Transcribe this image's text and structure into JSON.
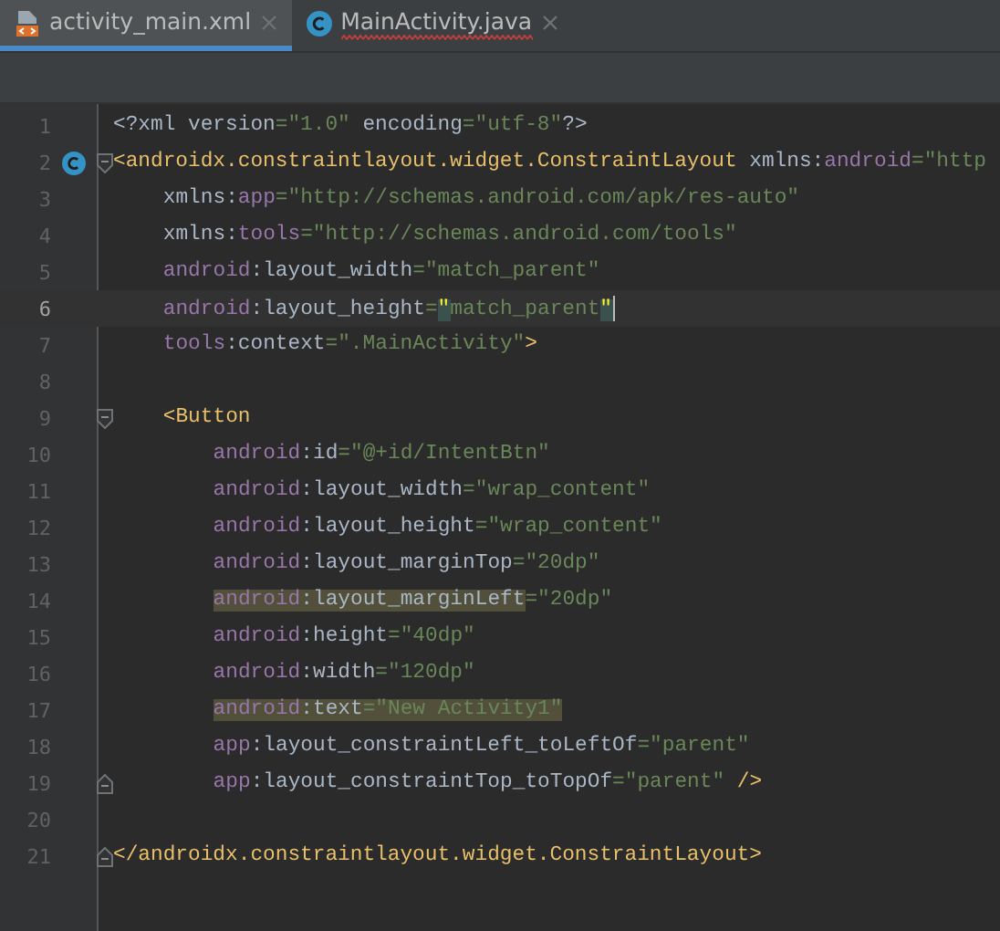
{
  "tabs": [
    {
      "label": "activity_main.xml",
      "kind": "xml",
      "selected": true,
      "misspelled": false
    },
    {
      "label": "MainActivity.java",
      "kind": "java",
      "selected": false,
      "misspelled": true
    }
  ],
  "lines": [
    {
      "number": "1",
      "current": false,
      "class_marker": false,
      "fold_start": false,
      "fold_end": false,
      "tokens": [
        {
          "kind": "plain",
          "text": "<?xml version"
        },
        {
          "kind": "value",
          "text": "=\"1.0\""
        },
        {
          "kind": "plain",
          "text": " encoding"
        },
        {
          "kind": "value",
          "text": "=\"utf-8\""
        },
        {
          "kind": "plain",
          "text": "?>"
        }
      ]
    },
    {
      "number": "2",
      "current": false,
      "class_marker": true,
      "fold_start": true,
      "fold_end": false,
      "tokens": [
        {
          "kind": "tag",
          "text": "<androidx.constraintlayout.widget.ConstraintLayout "
        },
        {
          "kind": "plain",
          "text": "xmlns:"
        },
        {
          "kind": "ns",
          "text": "android"
        },
        {
          "kind": "value",
          "text": "=\"http"
        }
      ],
      "children": [
        {
          "number": "3",
          "current": false,
          "class_marker": false,
          "fold_start": false,
          "fold_end": false,
          "tokens": [
            {
              "kind": "plain",
              "text": "xmlns:"
            },
            {
              "kind": "ns",
              "text": "app"
            },
            {
              "kind": "value",
              "text": "=\"http://schemas.android.com/apk/res-auto\""
            }
          ]
        },
        {
          "number": "4",
          "current": false,
          "class_marker": false,
          "fold_start": false,
          "fold_end": false,
          "tokens": [
            {
              "kind": "plain",
              "text": "xmlns:"
            },
            {
              "kind": "ns",
              "text": "tools"
            },
            {
              "kind": "value",
              "text": "=\"http://schemas.android.com/tools\""
            }
          ]
        },
        {
          "number": "5",
          "current": false,
          "class_marker": false,
          "fold_start": false,
          "fold_end": false,
          "tokens": [
            {
              "kind": "ns",
              "text": "android"
            },
            {
              "kind": "plain",
              "text": ":layout_width"
            },
            {
              "kind": "value",
              "text": "=\"match_parent\""
            }
          ]
        },
        {
          "number": "6",
          "current": true,
          "class_marker": false,
          "fold_start": false,
          "fold_end": false,
          "tokens": [
            {
              "kind": "ns",
              "text": "android"
            },
            {
              "kind": "plain",
              "text": ":layout_height"
            },
            {
              "kind": "value",
              "text": "="
            },
            {
              "kind": "value",
              "text": "\"",
              "matched": true
            },
            {
              "kind": "value",
              "text": "match_parent"
            },
            {
              "kind": "value",
              "text": "\"",
              "matched": true
            }
          ]
        },
        {
          "number": "7",
          "current": false,
          "class_marker": false,
          "fold_start": false,
          "fold_end": false,
          "tokens": [
            {
              "kind": "ns",
              "text": "tools"
            },
            {
              "kind": "plain",
              "text": ":context"
            },
            {
              "kind": "value",
              "text": "=\".MainActivity\""
            },
            {
              "kind": "tag",
              "text": ">"
            }
          ]
        },
        {
          "number": "8",
          "current": false,
          "class_marker": false,
          "fold_start": false,
          "fold_end": false
        },
        {
          "number": "9",
          "current": false,
          "class_marker": false,
          "fold_start": true,
          "fold_end": false,
          "tokens": [
            {
              "kind": "tag",
              "text": "<Button"
            }
          ],
          "children": [
            {
              "number": "10",
              "current": false,
              "class_marker": false,
              "fold_start": false,
              "fold_end": false,
              "tokens": [
                {
                  "kind": "ns",
                  "text": "android"
                },
                {
                  "kind": "plain",
                  "text": ":id"
                },
                {
                  "kind": "value",
                  "text": "=\"@+id/IntentBtn\""
                }
              ]
            },
            {
              "number": "11",
              "current": false,
              "class_marker": false,
              "fold_start": false,
              "fold_end": false,
              "tokens": [
                {
                  "kind": "ns",
                  "text": "android"
                },
                {
                  "kind": "plain",
                  "text": ":layout_width"
                },
                {
                  "kind": "value",
                  "text": "=\"wrap_content\""
                }
              ]
            },
            {
              "number": "12",
              "current": false,
              "class_marker": false,
              "fold_start": false,
              "fold_end": false,
              "tokens": [
                {
                  "kind": "ns",
                  "text": "android"
                },
                {
                  "kind": "plain",
                  "text": ":layout_height"
                },
                {
                  "kind": "value",
                  "text": "=\"wrap_content\""
                }
              ]
            },
            {
              "number": "13",
              "current": false,
              "class_marker": false,
              "fold_start": false,
              "fold_end": false,
              "tokens": [
                {
                  "kind": "ns",
                  "text": "android"
                },
                {
                  "kind": "plain",
                  "text": ":layout_marginTop"
                },
                {
                  "kind": "value",
                  "text": "=\"20dp\""
                }
              ]
            },
            {
              "number": "14",
              "current": false,
              "class_marker": false,
              "fold_start": false,
              "fold_end": false,
              "tokens": [
                {
                  "kind": "ns",
                  "text": "android",
                  "highlight": true
                },
                {
                  "kind": "plain",
                  "text": ":layout_marginLeft",
                  "highlight": true
                },
                {
                  "kind": "value",
                  "text": "=\"20dp\""
                }
              ]
            },
            {
              "number": "15",
              "current": false,
              "class_marker": false,
              "fold_start": false,
              "fold_end": false,
              "tokens": [
                {
                  "kind": "ns",
                  "text": "android"
                },
                {
                  "kind": "plain",
                  "text": ":height"
                },
                {
                  "kind": "value",
                  "text": "=\"40dp\""
                }
              ]
            },
            {
              "number": "16",
              "current": false,
              "class_marker": false,
              "fold_start": false,
              "fold_end": false,
              "tokens": [
                {
                  "kind": "ns",
                  "text": "android"
                },
                {
                  "kind": "plain",
                  "text": ":width"
                },
                {
                  "kind": "value",
                  "text": "=\"120dp\""
                }
              ]
            },
            {
              "number": "17",
              "current": false,
              "class_marker": false,
              "fold_start": false,
              "fold_end": false,
              "tokens": [
                {
                  "kind": "ns",
                  "text": "android",
                  "highlight": true
                },
                {
                  "kind": "plain",
                  "text": ":text",
                  "highlight": true
                },
                {
                  "kind": "value",
                  "text": "=\"New Activity1\"",
                  "highlight": true
                }
              ]
            },
            {
              "number": "18",
              "current": false,
              "class_marker": false,
              "fold_start": false,
              "fold_end": false,
              "tokens": [
                {
                  "kind": "ns",
                  "text": "app"
                },
                {
                  "kind": "plain",
                  "text": ":layout_constraintLeft_toLeftOf"
                },
                {
                  "kind": "value",
                  "text": "=\"parent\""
                }
              ]
            },
            {
              "number": "19",
              "current": false,
              "class_marker": false,
              "fold_start": false,
              "fold_end": true,
              "tokens": [
                {
                  "kind": "ns",
                  "text": "app"
                },
                {
                  "kind": "plain",
                  "text": ":layout_constraintTop_toTopOf"
                },
                {
                  "kind": "value",
                  "text": "=\"parent\""
                },
                {
                  "kind": "tag",
                  "text": " />"
                }
              ]
            }
          ]
        },
        {
          "number": "20",
          "current": false,
          "class_marker": false,
          "fold_start": false,
          "fold_end": false
        }
      ]
    },
    {
      "number": "21",
      "current": false,
      "class_marker": false,
      "fold_start": false,
      "fold_end": true,
      "tokens": [
        {
          "kind": "tag",
          "text": "</androidx.constraintlayout.widget.ConstraintLayout>"
        }
      ]
    }
  ]
}
